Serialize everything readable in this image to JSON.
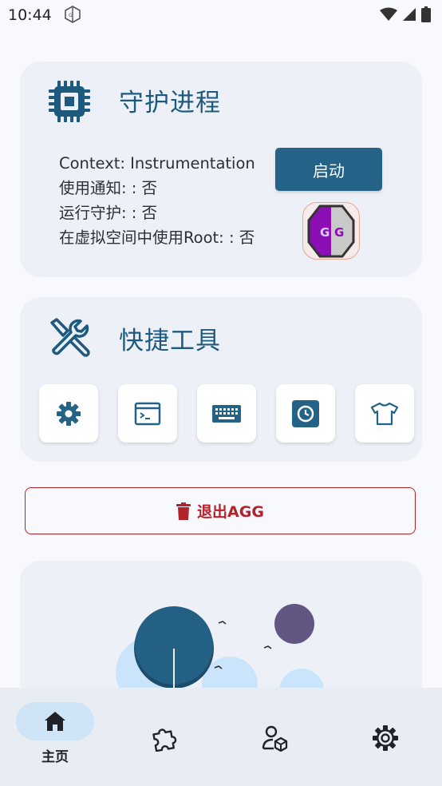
{
  "status_bar": {
    "time": "10:44"
  },
  "guard_card": {
    "title": "守护进程",
    "context_line": "Context: Instrumentation",
    "notify_line": "使用通知: : 否",
    "guard_line": "运行守护: : 否",
    "root_line": "在虚拟空间中使用Root: : 否",
    "start_label": "启动",
    "app_logo_text": "GG"
  },
  "tools_card": {
    "title": "快捷工具",
    "tools": [
      {
        "icon": "settings-icon"
      },
      {
        "icon": "terminal-icon"
      },
      {
        "icon": "keyboard-icon"
      },
      {
        "icon": "time-settings-icon"
      },
      {
        "icon": "shirt-icon"
      }
    ]
  },
  "exit_button": {
    "label": "退出AGG"
  },
  "bottom_nav": {
    "items": [
      {
        "icon": "home-icon",
        "label": "主页"
      },
      {
        "icon": "puzzle-icon",
        "label": ""
      },
      {
        "icon": "user-box-icon",
        "label": ""
      },
      {
        "icon": "gear-icon",
        "label": ""
      }
    ]
  },
  "colors": {
    "accent": "#256287",
    "title": "#1e5a7e",
    "danger": "#b3222b",
    "card": "#edf1f7",
    "background": "#f7f9fd",
    "nav_active": "#cfe4f7"
  }
}
